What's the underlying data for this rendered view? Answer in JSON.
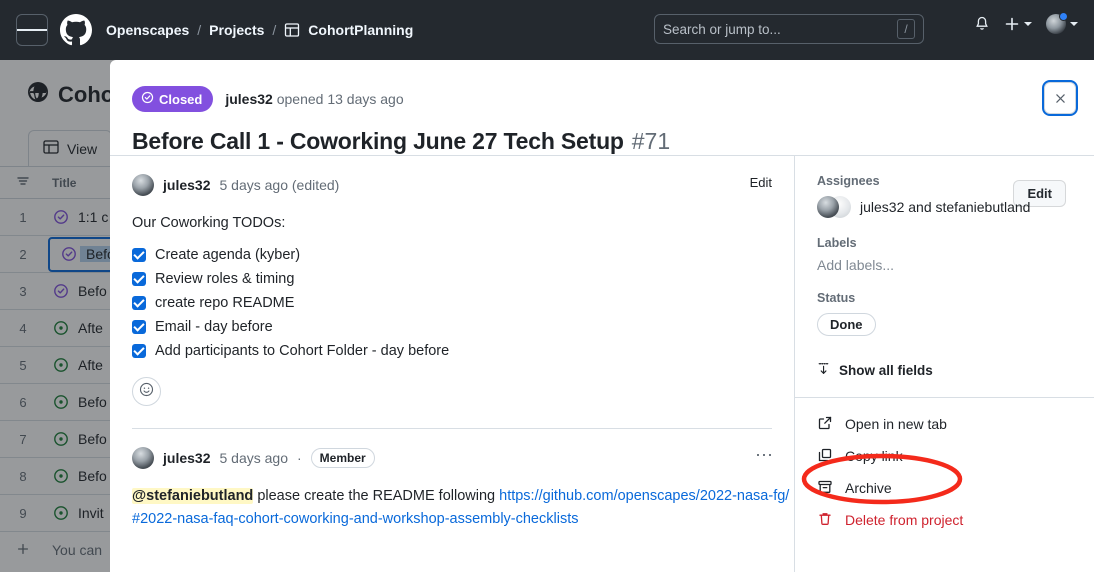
{
  "topnav": {
    "hamburger_label": "menu",
    "logo": "github-logo",
    "breadcrumb": [
      {
        "label": "Openscapes",
        "icon": null
      },
      {
        "label": "Projects",
        "icon": null
      },
      {
        "label": "CohortPlanning",
        "icon": "project-table-icon"
      }
    ],
    "separator": "/",
    "search": {
      "placeholder": "Search or jump to...",
      "shortcut": "/"
    },
    "notifications_icon": "bell-icon",
    "plus_icon": "plus-icon",
    "avatar": "user-avatar"
  },
  "background": {
    "project_title": "Cohort",
    "project_icon": "globe-icon",
    "tab": {
      "label": "View",
      "icon": "table-icon"
    },
    "filter_icon": "filter-icon",
    "column_header": "Title",
    "rows": [
      {
        "num": "1",
        "status": "closed",
        "title": "1:1 c"
      },
      {
        "num": "2",
        "status": "closed",
        "title": "Befo",
        "selected": true
      },
      {
        "num": "3",
        "status": "closed",
        "title": "Befo"
      },
      {
        "num": "4",
        "status": "open",
        "title": "Afte"
      },
      {
        "num": "5",
        "status": "open",
        "title": "Afte"
      },
      {
        "num": "6",
        "status": "open",
        "title": "Befo"
      },
      {
        "num": "7",
        "status": "open",
        "title": "Befo"
      },
      {
        "num": "8",
        "status": "open",
        "title": "Befo"
      },
      {
        "num": "9",
        "status": "open",
        "title": "Invit"
      }
    ],
    "add_row": {
      "icon": "plus-icon",
      "label": "You can"
    }
  },
  "modal": {
    "state_badge": {
      "label": "Closed",
      "icon": "issue-closed-icon",
      "color": "#8250df"
    },
    "opened_by_user": "jules32",
    "opened_by_text": "opened 13 days ago",
    "title": "Before Call 1 - Coworking June 27 Tech Setup",
    "number": "#71",
    "edit_button": "Edit",
    "close_button_icon": "close-icon",
    "comments": [
      {
        "author": "jules32",
        "timestamp": "5 days ago (edited)",
        "action_label": "Edit",
        "body_intro": "Our Coworking TODOs:",
        "todos": [
          {
            "checked": true,
            "label": "Create agenda (kyber)"
          },
          {
            "checked": true,
            "label": "Review roles & timing"
          },
          {
            "checked": true,
            "label": "create repo README"
          },
          {
            "checked": true,
            "label": "Email - day before"
          },
          {
            "checked": true,
            "label": "Add participants to Cohort Folder - day before"
          }
        ],
        "reaction_icon": "smiley-icon"
      },
      {
        "author": "jules32",
        "timestamp": "5 days ago",
        "separator": "·",
        "role_badge": "Member",
        "more_icon": "kebab-icon",
        "mention": "@stefaniebutland",
        "text_before_link": " please create the README following ",
        "link_line1": "https://github.com/openscapes/2022-",
        "link_line2": "nasa-fg/#2022-nasa-faq-cohort-coworking-and-workshop-assembly-checklists"
      }
    ],
    "sidebar": {
      "sections": [
        {
          "label": "Assignees",
          "value": "jules32 and stefaniebutland",
          "type": "assignees"
        },
        {
          "label": "Labels",
          "value": "Add labels...",
          "type": "placeholder"
        },
        {
          "label": "Status",
          "value": "Done",
          "type": "pill"
        }
      ],
      "show_all_fields": {
        "label": "Show all fields",
        "icon": "fold-down-icon"
      },
      "menu": [
        {
          "label": "Open in new tab",
          "icon": "external-link-icon",
          "danger": false,
          "highlighted": true
        },
        {
          "label": "Copy link",
          "icon": "copy-icon",
          "danger": false
        },
        {
          "label": "Archive",
          "icon": "archive-icon",
          "danger": false
        },
        {
          "label": "Delete from project",
          "icon": "trash-icon",
          "danger": true
        }
      ]
    }
  },
  "annotation": {
    "shape": "ellipse",
    "color": "#f42a1b",
    "target": "Open in new tab"
  }
}
